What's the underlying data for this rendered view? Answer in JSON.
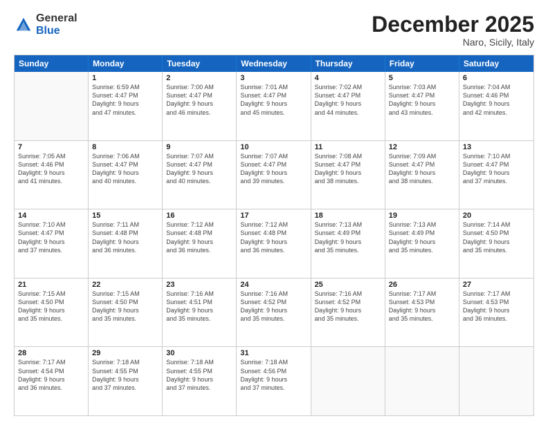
{
  "logo": {
    "general": "General",
    "blue": "Blue"
  },
  "title": "December 2025",
  "subtitle": "Naro, Sicily, Italy",
  "header_days": [
    "Sunday",
    "Monday",
    "Tuesday",
    "Wednesday",
    "Thursday",
    "Friday",
    "Saturday"
  ],
  "weeks": [
    [
      {
        "day": "",
        "info": ""
      },
      {
        "day": "1",
        "info": "Sunrise: 6:59 AM\nSunset: 4:47 PM\nDaylight: 9 hours\nand 47 minutes."
      },
      {
        "day": "2",
        "info": "Sunrise: 7:00 AM\nSunset: 4:47 PM\nDaylight: 9 hours\nand 46 minutes."
      },
      {
        "day": "3",
        "info": "Sunrise: 7:01 AM\nSunset: 4:47 PM\nDaylight: 9 hours\nand 45 minutes."
      },
      {
        "day": "4",
        "info": "Sunrise: 7:02 AM\nSunset: 4:47 PM\nDaylight: 9 hours\nand 44 minutes."
      },
      {
        "day": "5",
        "info": "Sunrise: 7:03 AM\nSunset: 4:47 PM\nDaylight: 9 hours\nand 43 minutes."
      },
      {
        "day": "6",
        "info": "Sunrise: 7:04 AM\nSunset: 4:46 PM\nDaylight: 9 hours\nand 42 minutes."
      }
    ],
    [
      {
        "day": "7",
        "info": "Sunrise: 7:05 AM\nSunset: 4:46 PM\nDaylight: 9 hours\nand 41 minutes."
      },
      {
        "day": "8",
        "info": "Sunrise: 7:06 AM\nSunset: 4:47 PM\nDaylight: 9 hours\nand 40 minutes."
      },
      {
        "day": "9",
        "info": "Sunrise: 7:07 AM\nSunset: 4:47 PM\nDaylight: 9 hours\nand 40 minutes."
      },
      {
        "day": "10",
        "info": "Sunrise: 7:07 AM\nSunset: 4:47 PM\nDaylight: 9 hours\nand 39 minutes."
      },
      {
        "day": "11",
        "info": "Sunrise: 7:08 AM\nSunset: 4:47 PM\nDaylight: 9 hours\nand 38 minutes."
      },
      {
        "day": "12",
        "info": "Sunrise: 7:09 AM\nSunset: 4:47 PM\nDaylight: 9 hours\nand 38 minutes."
      },
      {
        "day": "13",
        "info": "Sunrise: 7:10 AM\nSunset: 4:47 PM\nDaylight: 9 hours\nand 37 minutes."
      }
    ],
    [
      {
        "day": "14",
        "info": "Sunrise: 7:10 AM\nSunset: 4:47 PM\nDaylight: 9 hours\nand 37 minutes."
      },
      {
        "day": "15",
        "info": "Sunrise: 7:11 AM\nSunset: 4:48 PM\nDaylight: 9 hours\nand 36 minutes."
      },
      {
        "day": "16",
        "info": "Sunrise: 7:12 AM\nSunset: 4:48 PM\nDaylight: 9 hours\nand 36 minutes."
      },
      {
        "day": "17",
        "info": "Sunrise: 7:12 AM\nSunset: 4:48 PM\nDaylight: 9 hours\nand 36 minutes."
      },
      {
        "day": "18",
        "info": "Sunrise: 7:13 AM\nSunset: 4:49 PM\nDaylight: 9 hours\nand 35 minutes."
      },
      {
        "day": "19",
        "info": "Sunrise: 7:13 AM\nSunset: 4:49 PM\nDaylight: 9 hours\nand 35 minutes."
      },
      {
        "day": "20",
        "info": "Sunrise: 7:14 AM\nSunset: 4:50 PM\nDaylight: 9 hours\nand 35 minutes."
      }
    ],
    [
      {
        "day": "21",
        "info": "Sunrise: 7:15 AM\nSunset: 4:50 PM\nDaylight: 9 hours\nand 35 minutes."
      },
      {
        "day": "22",
        "info": "Sunrise: 7:15 AM\nSunset: 4:50 PM\nDaylight: 9 hours\nand 35 minutes."
      },
      {
        "day": "23",
        "info": "Sunrise: 7:16 AM\nSunset: 4:51 PM\nDaylight: 9 hours\nand 35 minutes."
      },
      {
        "day": "24",
        "info": "Sunrise: 7:16 AM\nSunset: 4:52 PM\nDaylight: 9 hours\nand 35 minutes."
      },
      {
        "day": "25",
        "info": "Sunrise: 7:16 AM\nSunset: 4:52 PM\nDaylight: 9 hours\nand 35 minutes."
      },
      {
        "day": "26",
        "info": "Sunrise: 7:17 AM\nSunset: 4:53 PM\nDaylight: 9 hours\nand 35 minutes."
      },
      {
        "day": "27",
        "info": "Sunrise: 7:17 AM\nSunset: 4:53 PM\nDaylight: 9 hours\nand 36 minutes."
      }
    ],
    [
      {
        "day": "28",
        "info": "Sunrise: 7:17 AM\nSunset: 4:54 PM\nDaylight: 9 hours\nand 36 minutes."
      },
      {
        "day": "29",
        "info": "Sunrise: 7:18 AM\nSunset: 4:55 PM\nDaylight: 9 hours\nand 37 minutes."
      },
      {
        "day": "30",
        "info": "Sunrise: 7:18 AM\nSunset: 4:55 PM\nDaylight: 9 hours\nand 37 minutes."
      },
      {
        "day": "31",
        "info": "Sunrise: 7:18 AM\nSunset: 4:56 PM\nDaylight: 9 hours\nand 37 minutes."
      },
      {
        "day": "",
        "info": ""
      },
      {
        "day": "",
        "info": ""
      },
      {
        "day": "",
        "info": ""
      }
    ]
  ]
}
